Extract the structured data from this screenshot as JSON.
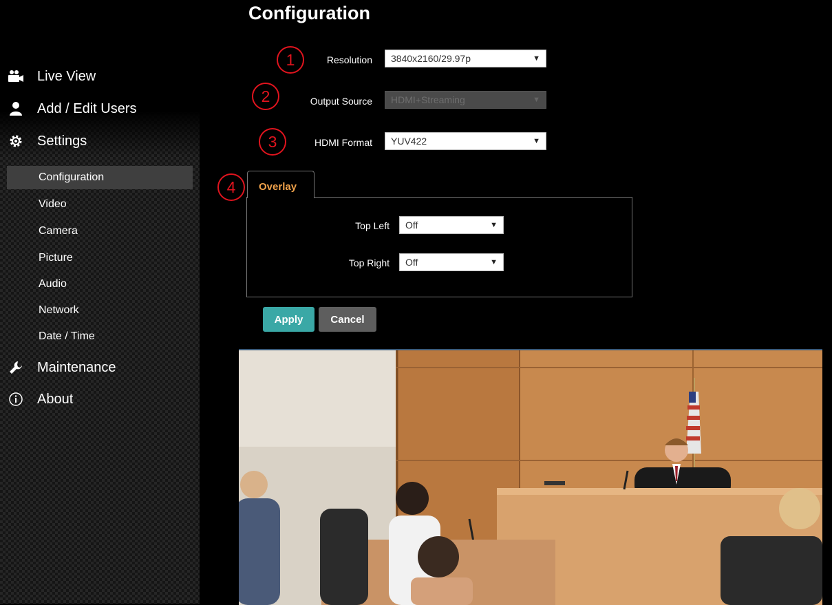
{
  "page": {
    "title": "Configuration"
  },
  "sidebar": {
    "main_items": [
      {
        "label": "Live View",
        "icon": "camera-icon"
      },
      {
        "label": "Add / Edit Users",
        "icon": "user-icon"
      },
      {
        "label": "Settings",
        "icon": "gear-icon"
      },
      {
        "label": "Maintenance",
        "icon": "wrench-icon"
      },
      {
        "label": "About",
        "icon": "info-icon"
      }
    ],
    "settings_items": [
      {
        "label": "Configuration",
        "active": true
      },
      {
        "label": "Video"
      },
      {
        "label": "Camera"
      },
      {
        "label": "Picture"
      },
      {
        "label": "Audio"
      },
      {
        "label": "Network"
      },
      {
        "label": "Date / Time"
      }
    ]
  },
  "form": {
    "resolution": {
      "label": "Resolution",
      "value": "3840x2160/29.97p"
    },
    "output_source": {
      "label": "Output Source",
      "value": "HDMI+Streaming",
      "disabled": true
    },
    "hdmi_format": {
      "label": "HDMI Format",
      "value": "YUV422"
    }
  },
  "overlay": {
    "tab_label": "Overlay",
    "top_left": {
      "label": "Top Left",
      "value": "Off"
    },
    "top_right": {
      "label": "Top Right",
      "value": "Off"
    }
  },
  "buttons": {
    "apply": "Apply",
    "cancel": "Cancel"
  },
  "markers": [
    "1",
    "2",
    "3",
    "4"
  ],
  "colors": {
    "accent_teal": "#3aa8a6",
    "marker_red": "#e0141e",
    "tab_orange": "#f0a24b",
    "active_item": "#3f3f3f"
  },
  "preview": {
    "icon": "courtroom-video-feed"
  }
}
